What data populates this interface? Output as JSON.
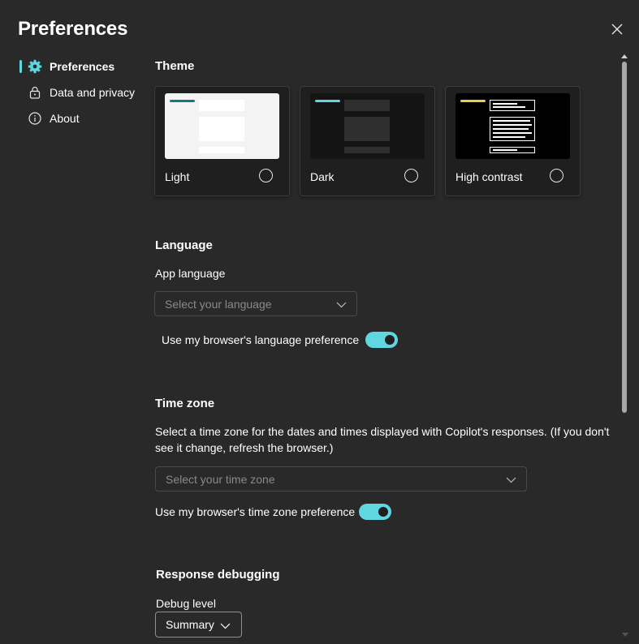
{
  "dialog": {
    "title": "Preferences"
  },
  "sidebar": {
    "items": [
      {
        "label": "Preferences",
        "icon": "gear-icon",
        "active": true
      },
      {
        "label": "Data and privacy",
        "icon": "lock-icon",
        "active": false
      },
      {
        "label": "About",
        "icon": "info-icon",
        "active": false
      }
    ]
  },
  "theme": {
    "title": "Theme",
    "options": [
      {
        "label": "Light",
        "selected": false
      },
      {
        "label": "Dark",
        "selected": false
      },
      {
        "label": "High contrast",
        "selected": false
      }
    ]
  },
  "language": {
    "title": "Language",
    "app_language_label": "App language",
    "dropdown_placeholder": "Select your language",
    "toggle_label": "Use my browser's language preference",
    "toggle_on": true
  },
  "timezone": {
    "title": "Time zone",
    "description_line1": "Select a time zone for the dates and times displayed with Copilot's responses. (If you don't",
    "description_line2": "see it change, refresh the browser.)",
    "dropdown_placeholder": "Select your time zone",
    "toggle_label": "Use my browser's time zone preference",
    "toggle_on": true
  },
  "debugging": {
    "title": "Response debugging",
    "debug_level_label": "Debug level",
    "debug_level_value": "Summary"
  },
  "colors": {
    "accent": "#5fd6e0",
    "background": "#292929",
    "hc_accent": "#e3d24a"
  }
}
